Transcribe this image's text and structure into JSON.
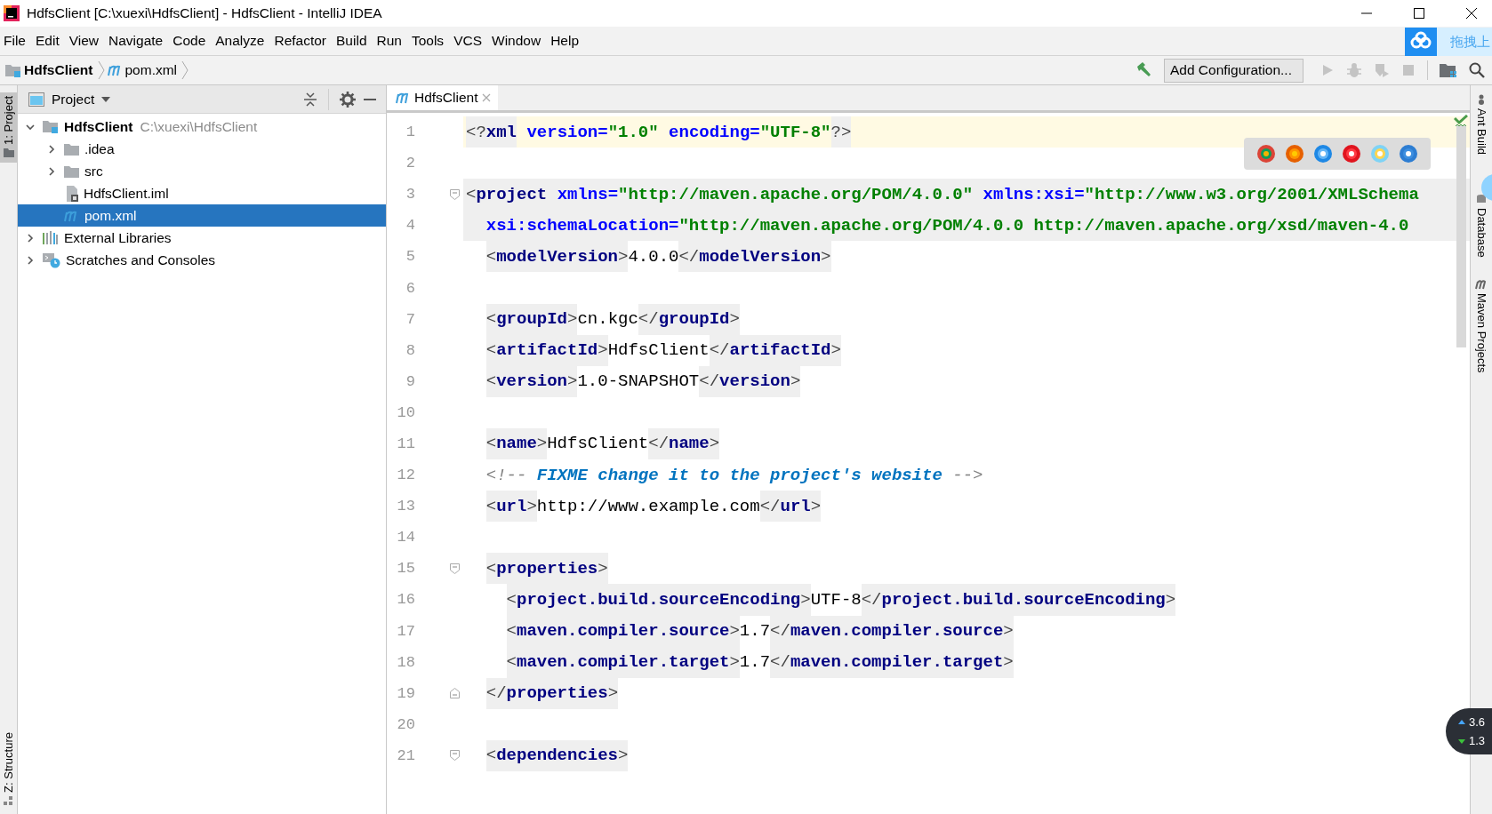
{
  "window": {
    "title": "HdfsClient [C:\\xuexi\\HdfsClient] - HdfsClient - IntelliJ IDEA"
  },
  "menu": [
    {
      "label": "File"
    },
    {
      "label": "Edit"
    },
    {
      "label": "View"
    },
    {
      "label": "Navigate"
    },
    {
      "label": "Code"
    },
    {
      "label": "Analyze"
    },
    {
      "label": "Refactor"
    },
    {
      "label": "Build"
    },
    {
      "label": "Run"
    },
    {
      "label": "Tools"
    },
    {
      "label": "VCS"
    },
    {
      "label": "Window"
    },
    {
      "label": "Help"
    }
  ],
  "overlay_button": {
    "label": "拖拽上"
  },
  "breadcrumbs": [
    {
      "label": "HdfsClient",
      "kind": "project"
    },
    {
      "label": "pom.xml",
      "kind": "maven"
    }
  ],
  "toolbar": {
    "run_configuration": "Add Configuration...",
    "actions": [
      {
        "kind": "build",
        "disabled": false
      },
      {
        "kind": "run",
        "disabled": true
      },
      {
        "kind": "debug",
        "disabled": true
      },
      {
        "kind": "coverage",
        "disabled": true
      },
      {
        "kind": "stop",
        "disabled": true
      },
      {
        "kind": "structure",
        "disabled": false
      },
      {
        "kind": "search",
        "disabled": false
      }
    ]
  },
  "left_tool_strip": [
    {
      "label": "1: Project",
      "selected": true
    },
    {
      "label": "Z: Structure",
      "selected": false
    }
  ],
  "project_panel": {
    "title": "Project",
    "tree": [
      {
        "label": "HdfsClient",
        "path": "C:\\xuexi\\HdfsClient",
        "kind": "module",
        "expanded": true,
        "selected": false,
        "children": [
          {
            "label": ".idea",
            "kind": "folder",
            "expanded": false,
            "selected": false
          },
          {
            "label": "src",
            "kind": "folder",
            "expanded": false,
            "selected": false
          },
          {
            "label": "HdfsClient.iml",
            "kind": "iml",
            "selected": false
          },
          {
            "label": "pom.xml",
            "kind": "maven",
            "selected": true
          }
        ]
      },
      {
        "label": "External Libraries",
        "kind": "libraries",
        "expanded": false,
        "selected": false
      },
      {
        "label": "Scratches and Consoles",
        "kind": "scratches",
        "expanded": false,
        "selected": false
      }
    ]
  },
  "editor": {
    "tabs": [
      {
        "label": "HdfsClient",
        "selected": true
      }
    ],
    "lines": [
      {
        "number": "1",
        "kind": "current",
        "fold_start": false,
        "fold_end": false,
        "tokens": [
          {
            "kind": "tag",
            "parts": [
              "<?",
              "xml"
            ]
          },
          {
            "kind": "attr",
            "text": " version="
          },
          {
            "kind": "value",
            "text": "\"1.0\""
          },
          {
            "kind": "attr",
            "text": " encoding="
          },
          {
            "kind": "value",
            "text": "\"UTF-8\""
          },
          {
            "kind": "tag",
            "parts": [
              "?>"
            ]
          }
        ]
      },
      {
        "number": "2",
        "kind": "plain",
        "fold_start": false,
        "fold_end": false
      },
      {
        "number": "3",
        "kind": "tag",
        "fold_start": true,
        "fold_end": false,
        "tokens": [
          {
            "kind": "tag",
            "parts": [
              "<",
              "project"
            ]
          },
          {
            "kind": "attr",
            "text": " xmlns="
          },
          {
            "kind": "value",
            "text": "\"http://maven.apache.org/POM/4.0.0\""
          },
          {
            "kind": "attr",
            "text": " xmlns:xsi="
          },
          {
            "kind": "value",
            "text": "\"http://www.w3.org/2001/XMLSchema"
          }
        ]
      },
      {
        "number": "4",
        "kind": "tag",
        "fold_start": false,
        "fold_end": false,
        "tokens": [
          {
            "kind": "indent"
          },
          {
            "kind": "attr",
            "text": "xsi:schemaLocation="
          },
          {
            "kind": "value",
            "text": "\"http://maven.apache.org/POM/4.0.0 http://maven.apache.org/xsd/maven-4.0"
          }
        ]
      },
      {
        "number": "5",
        "kind": "plain",
        "fold_start": false,
        "fold_end": false,
        "tokens": [
          {
            "kind": "indent"
          },
          {
            "kind": "tag",
            "parts": [
              "<",
              "modelVersion",
              ">"
            ]
          },
          {
            "kind": "text",
            "text": "4.0.0"
          },
          {
            "kind": "tag",
            "parts": [
              "</",
              "modelVersion",
              ">"
            ]
          }
        ]
      },
      {
        "number": "6",
        "kind": "plain",
        "fold_start": false,
        "fold_end": false
      },
      {
        "number": "7",
        "kind": "plain",
        "fold_start": false,
        "fold_end": false,
        "tokens": [
          {
            "kind": "indent"
          },
          {
            "kind": "tag",
            "parts": [
              "<",
              "groupId",
              ">"
            ]
          },
          {
            "kind": "text",
            "text": "cn.kgc"
          },
          {
            "kind": "tag",
            "parts": [
              "</",
              "groupId",
              ">"
            ]
          }
        ]
      },
      {
        "number": "8",
        "kind": "plain",
        "fold_start": false,
        "fold_end": false,
        "tokens": [
          {
            "kind": "indent"
          },
          {
            "kind": "tag",
            "parts": [
              "<",
              "artifactId",
              ">"
            ]
          },
          {
            "kind": "text",
            "text": "HdfsClient"
          },
          {
            "kind": "tag",
            "parts": [
              "</",
              "artifactId",
              ">"
            ]
          }
        ]
      },
      {
        "number": "9",
        "kind": "plain",
        "fold_start": false,
        "fold_end": false,
        "tokens": [
          {
            "kind": "indent"
          },
          {
            "kind": "tag",
            "parts": [
              "<",
              "version",
              ">"
            ]
          },
          {
            "kind": "text",
            "text": "1.0-SNAPSHOT"
          },
          {
            "kind": "tag",
            "parts": [
              "</",
              "version",
              ">"
            ]
          }
        ]
      },
      {
        "number": "10",
        "kind": "plain",
        "fold_start": false,
        "fold_end": false
      },
      {
        "number": "11",
        "kind": "plain",
        "fold_start": false,
        "fold_end": false,
        "tokens": [
          {
            "kind": "indent"
          },
          {
            "kind": "tag",
            "parts": [
              "<",
              "name",
              ">"
            ]
          },
          {
            "kind": "text",
            "text": "HdfsClient"
          },
          {
            "kind": "tag",
            "parts": [
              "</",
              "name",
              ">"
            ]
          }
        ]
      },
      {
        "number": "12",
        "kind": "plain",
        "fold_start": false,
        "fold_end": false,
        "tokens": [
          {
            "kind": "indent"
          },
          {
            "kind": "comment",
            "text": "<!-- "
          },
          {
            "kind": "todo",
            "text": "FIXME change it to the project's website"
          },
          {
            "kind": "comment",
            "text": " -->"
          }
        ]
      },
      {
        "number": "13",
        "kind": "plain",
        "fold_start": false,
        "fold_end": false,
        "tokens": [
          {
            "kind": "indent"
          },
          {
            "kind": "tag",
            "parts": [
              "<",
              "url",
              ">"
            ]
          },
          {
            "kind": "text",
            "text": "http://www.example.com"
          },
          {
            "kind": "tag",
            "parts": [
              "</",
              "url",
              ">"
            ]
          }
        ]
      },
      {
        "number": "14",
        "kind": "plain",
        "fold_start": false,
        "fold_end": false
      },
      {
        "number": "15",
        "kind": "plain",
        "fold_start": true,
        "fold_end": false,
        "tokens": [
          {
            "kind": "indent"
          },
          {
            "kind": "tag",
            "parts": [
              "<",
              "properties",
              ">"
            ]
          }
        ]
      },
      {
        "number": "16",
        "kind": "plain",
        "fold_start": false,
        "fold_end": false,
        "tokens": [
          {
            "kind": "indent2"
          },
          {
            "kind": "tag",
            "parts": [
              "<",
              "project.build.sourceEncoding",
              ">"
            ]
          },
          {
            "kind": "text",
            "text": "UTF-8"
          },
          {
            "kind": "tag",
            "parts": [
              "</",
              "project.build.sourceEncoding",
              ">"
            ]
          }
        ]
      },
      {
        "number": "17",
        "kind": "plain",
        "fold_start": false,
        "fold_end": false,
        "tokens": [
          {
            "kind": "indent2"
          },
          {
            "kind": "tag",
            "parts": [
              "<",
              "maven.compiler.source",
              ">"
            ]
          },
          {
            "kind": "text",
            "text": "1.7"
          },
          {
            "kind": "tag",
            "parts": [
              "</",
              "maven.compiler.source",
              ">"
            ]
          }
        ]
      },
      {
        "number": "18",
        "kind": "plain",
        "fold_start": false,
        "fold_end": false,
        "tokens": [
          {
            "kind": "indent2"
          },
          {
            "kind": "tag",
            "parts": [
              "<",
              "maven.compiler.target",
              ">"
            ]
          },
          {
            "kind": "text",
            "text": "1.7"
          },
          {
            "kind": "tag",
            "parts": [
              "</",
              "maven.compiler.target",
              ">"
            ]
          }
        ]
      },
      {
        "number": "19",
        "kind": "plain",
        "fold_start": false,
        "fold_end": true,
        "tokens": [
          {
            "kind": "indent"
          },
          {
            "kind": "tag",
            "parts": [
              "</",
              "properties",
              ">"
            ]
          }
        ]
      },
      {
        "number": "20",
        "kind": "plain",
        "fold_start": false,
        "fold_end": false
      },
      {
        "number": "21",
        "kind": "plain",
        "fold_start": true,
        "fold_end": false,
        "tokens": [
          {
            "kind": "indent"
          },
          {
            "kind": "tag",
            "parts": [
              "<",
              "dependencies",
              ">"
            ]
          }
        ]
      }
    ]
  },
  "right_tool_strip": [
    {
      "label": "Ant Build",
      "kind": "ant"
    },
    {
      "label": "Database",
      "kind": "database"
    },
    {
      "label": "Maven Projects",
      "kind": "maven"
    }
  ],
  "network_speed": {
    "upload": "3.6",
    "download": "1.3"
  }
}
